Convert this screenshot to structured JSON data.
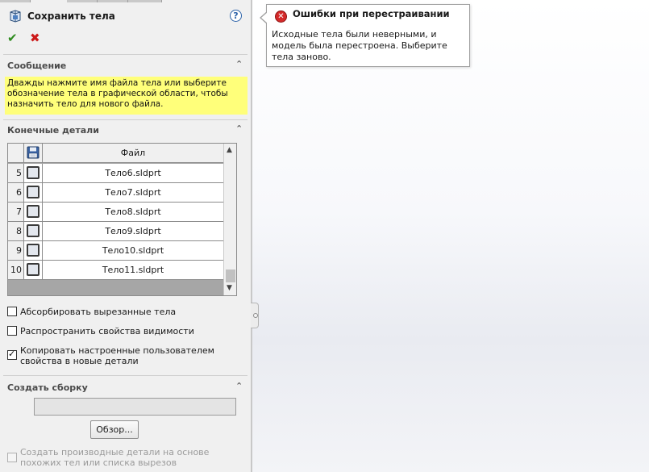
{
  "colors": {
    "panel_bg": "#f0f0f0",
    "message_bg": "#ffff7a",
    "ok_green": "#2e8b1e",
    "cancel_red": "#cc1a1a",
    "error_red": "#d42a2a",
    "help_blue": "#2c62a8"
  },
  "header": {
    "title": "Сохранить тела",
    "icon": "save-bodies-icon",
    "help_symbol": "?",
    "ok_symbol": "✔",
    "cancel_symbol": "✖"
  },
  "message_group": {
    "title": "Сообщение",
    "collapse_symbol": "⌃",
    "text": "Дважды нажмите имя файла тела или выберите обозначение тела в графической области, чтобы назначить тело для нового файла."
  },
  "resulting_parts": {
    "title": "Конечные детали",
    "collapse_symbol": "⌃",
    "column_header": "Файл",
    "rows": [
      {
        "num": "5",
        "file": "Тело6.sldprt",
        "checked": false
      },
      {
        "num": "6",
        "file": "Тело7.sldprt",
        "checked": false
      },
      {
        "num": "7",
        "file": "Тело8.sldprt",
        "checked": false
      },
      {
        "num": "8",
        "file": "Тело9.sldprt",
        "checked": false
      },
      {
        "num": "9",
        "file": "Тело10.sldprt",
        "checked": false
      },
      {
        "num": "10",
        "file": "Тело11.sldprt",
        "checked": false
      }
    ],
    "scroll_up_symbol": "▲",
    "scroll_down_symbol": "▼"
  },
  "options": {
    "absorb_cut_bodies": {
      "label": "Абсорбировать вырезанные тела",
      "checked": false
    },
    "propagate_visual": {
      "label": "Распространить свойства видимости",
      "checked": false
    },
    "copy_custom_props": {
      "label": "Копировать настроенные пользователем свойства в новые детали",
      "checked": true
    }
  },
  "create_assembly": {
    "title": "Создать сборку",
    "collapse_symbol": "⌃",
    "path_value": "",
    "browse_label": "Обзор...",
    "derived_parts": {
      "label": "Создать производные детали на основе похожих тел или списка вырезов",
      "checked": false,
      "enabled": false
    }
  },
  "error_tooltip": {
    "title": "Ошибки при перестраивании",
    "icon_symbol": "✕",
    "text": "Исходные тела были неверными, и модель была перестроена. Выберите тела заново."
  }
}
